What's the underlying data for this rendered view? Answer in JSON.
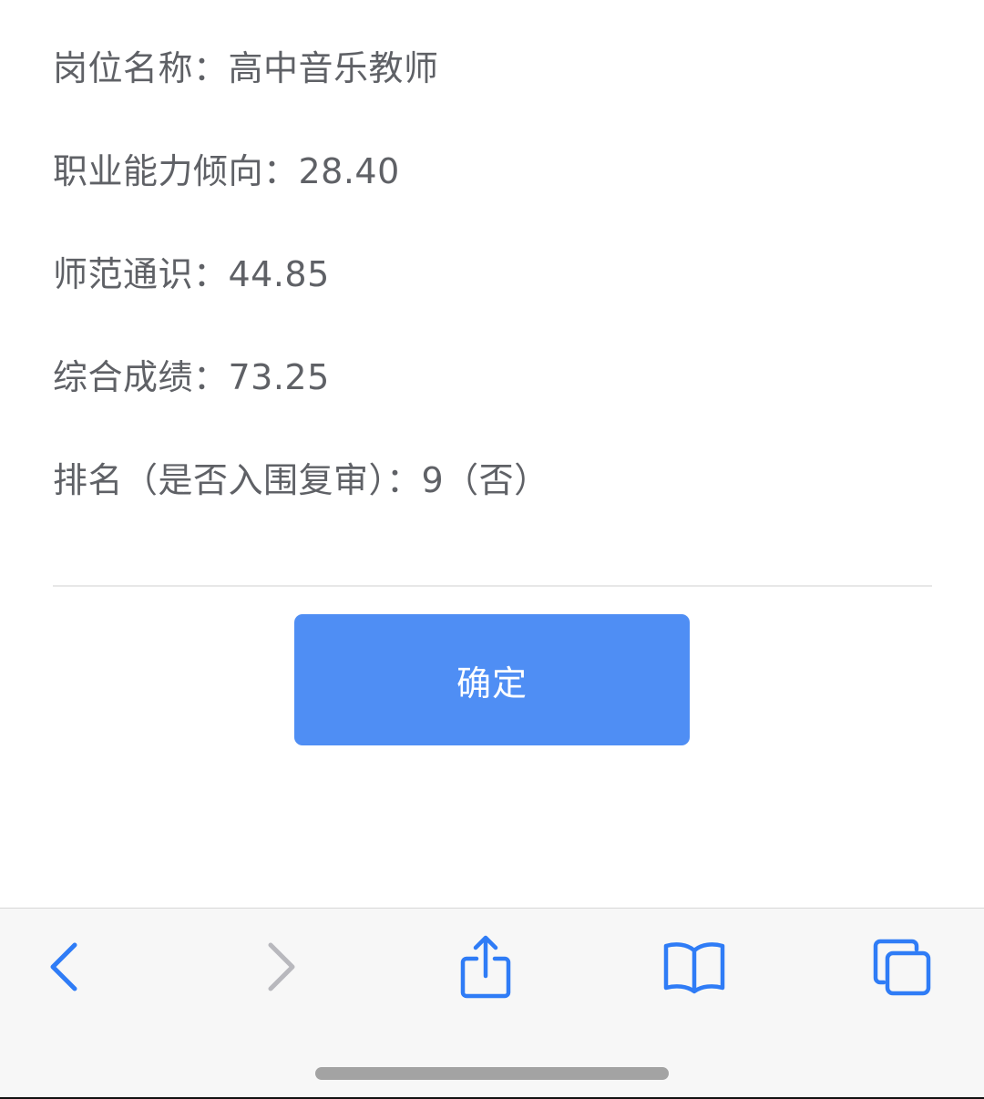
{
  "result": {
    "position": "岗位名称：高中音乐教师",
    "aptitude": "职业能力倾向：28.40",
    "general_knowledge": "师范通识：44.85",
    "total_score": "综合成绩：73.25",
    "ranking": "排名（是否入围复审）：9（否）"
  },
  "actions": {
    "confirm_label": "确定"
  },
  "colors": {
    "accent": "#4f8ef4",
    "text": "#5f6166",
    "toolbar_icon": "#2f7cf6",
    "toolbar_icon_disabled": "#b8b8bd",
    "toolbar_bg": "#f7f7f7"
  },
  "toolbar": {
    "icons": [
      "chevron-left-icon",
      "chevron-right-icon",
      "share-icon",
      "book-icon",
      "tabs-icon"
    ],
    "forward_enabled": false
  }
}
